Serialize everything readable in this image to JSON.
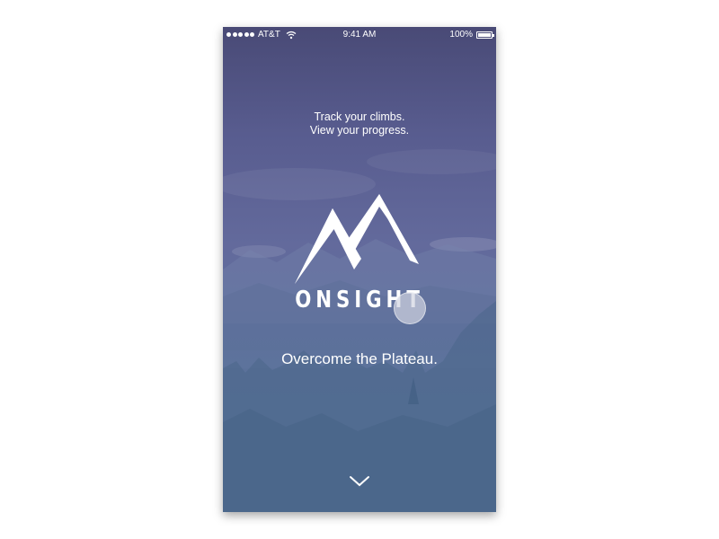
{
  "status_bar": {
    "carrier": "AT&T",
    "time": "9:41 AM",
    "battery": "100%",
    "signal_icon": "signal-dots-icon",
    "wifi_icon": "wifi-icon",
    "battery_icon": "battery-icon"
  },
  "splash": {
    "tagline_line1": "Track your climbs.",
    "tagline_line2": "View your progress.",
    "logo_icon": "mountain-logo-icon",
    "app_name": "ONSIGHT",
    "headline": "Overcome the Plateau.",
    "scroll_icon": "chevron-down-icon"
  },
  "colors": {
    "sky_top": "#494a76",
    "sky_bottom": "#587399",
    "text": "#ffffff"
  }
}
